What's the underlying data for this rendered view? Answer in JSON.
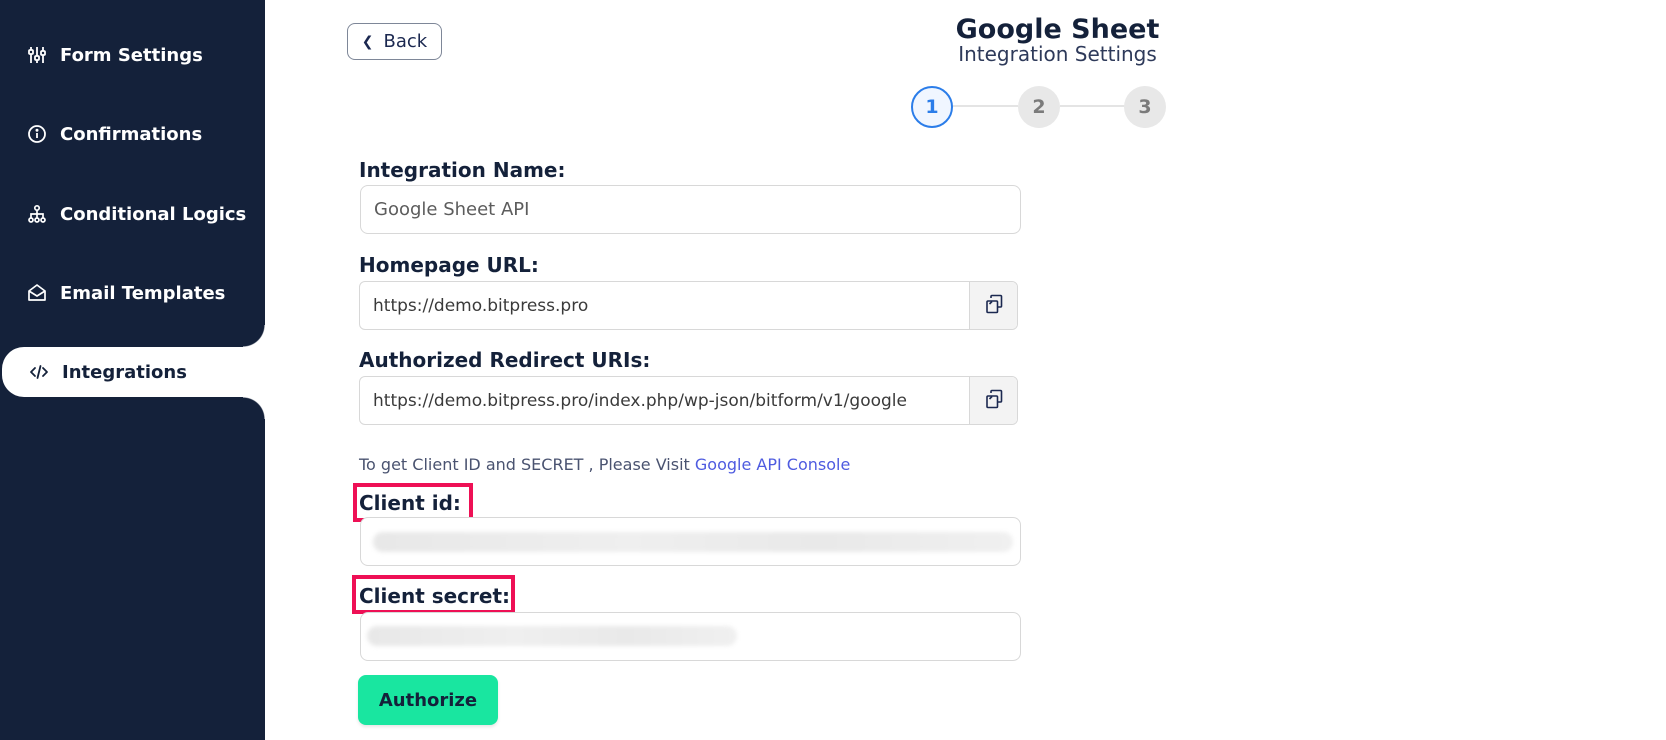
{
  "sidebar": {
    "items": [
      {
        "label": "Form Settings",
        "icon": "sliders-icon"
      },
      {
        "label": "Confirmations",
        "icon": "info-circle-icon"
      },
      {
        "label": "Conditional Logics",
        "icon": "sitemap-icon"
      },
      {
        "label": "Email Templates",
        "icon": "envelope-open-icon"
      },
      {
        "label": "Integrations",
        "icon": "code-icon",
        "active": true
      }
    ]
  },
  "header": {
    "back_label": "Back",
    "title": "Google Sheet",
    "subtitle": "Integration Settings"
  },
  "stepper": {
    "steps": [
      "1",
      "2",
      "3"
    ],
    "current": 1
  },
  "form": {
    "integration_name_label": "Integration Name:",
    "integration_name_value": "Google Sheet API",
    "homepage_url_label": "Homepage URL:",
    "homepage_url_value": "https://demo.bitpress.pro",
    "redirect_uris_label": "Authorized Redirect URIs:",
    "redirect_uris_value": "https://demo.bitpress.pro/index.php/wp-json/bitform/v1/google",
    "hint_text": "To get Client ID and SECRET , Please Visit ",
    "hint_link": "Google API Console",
    "client_id_label": "Client id:",
    "client_secret_label": "Client secret:",
    "authorize_label": "Authorize"
  },
  "colors": {
    "sidebar_bg": "#14213a",
    "accent_blue": "#2b7de9",
    "authorize_green": "#19e6a0",
    "highlight_red": "#ee1055",
    "link_color": "#4e5be0"
  }
}
